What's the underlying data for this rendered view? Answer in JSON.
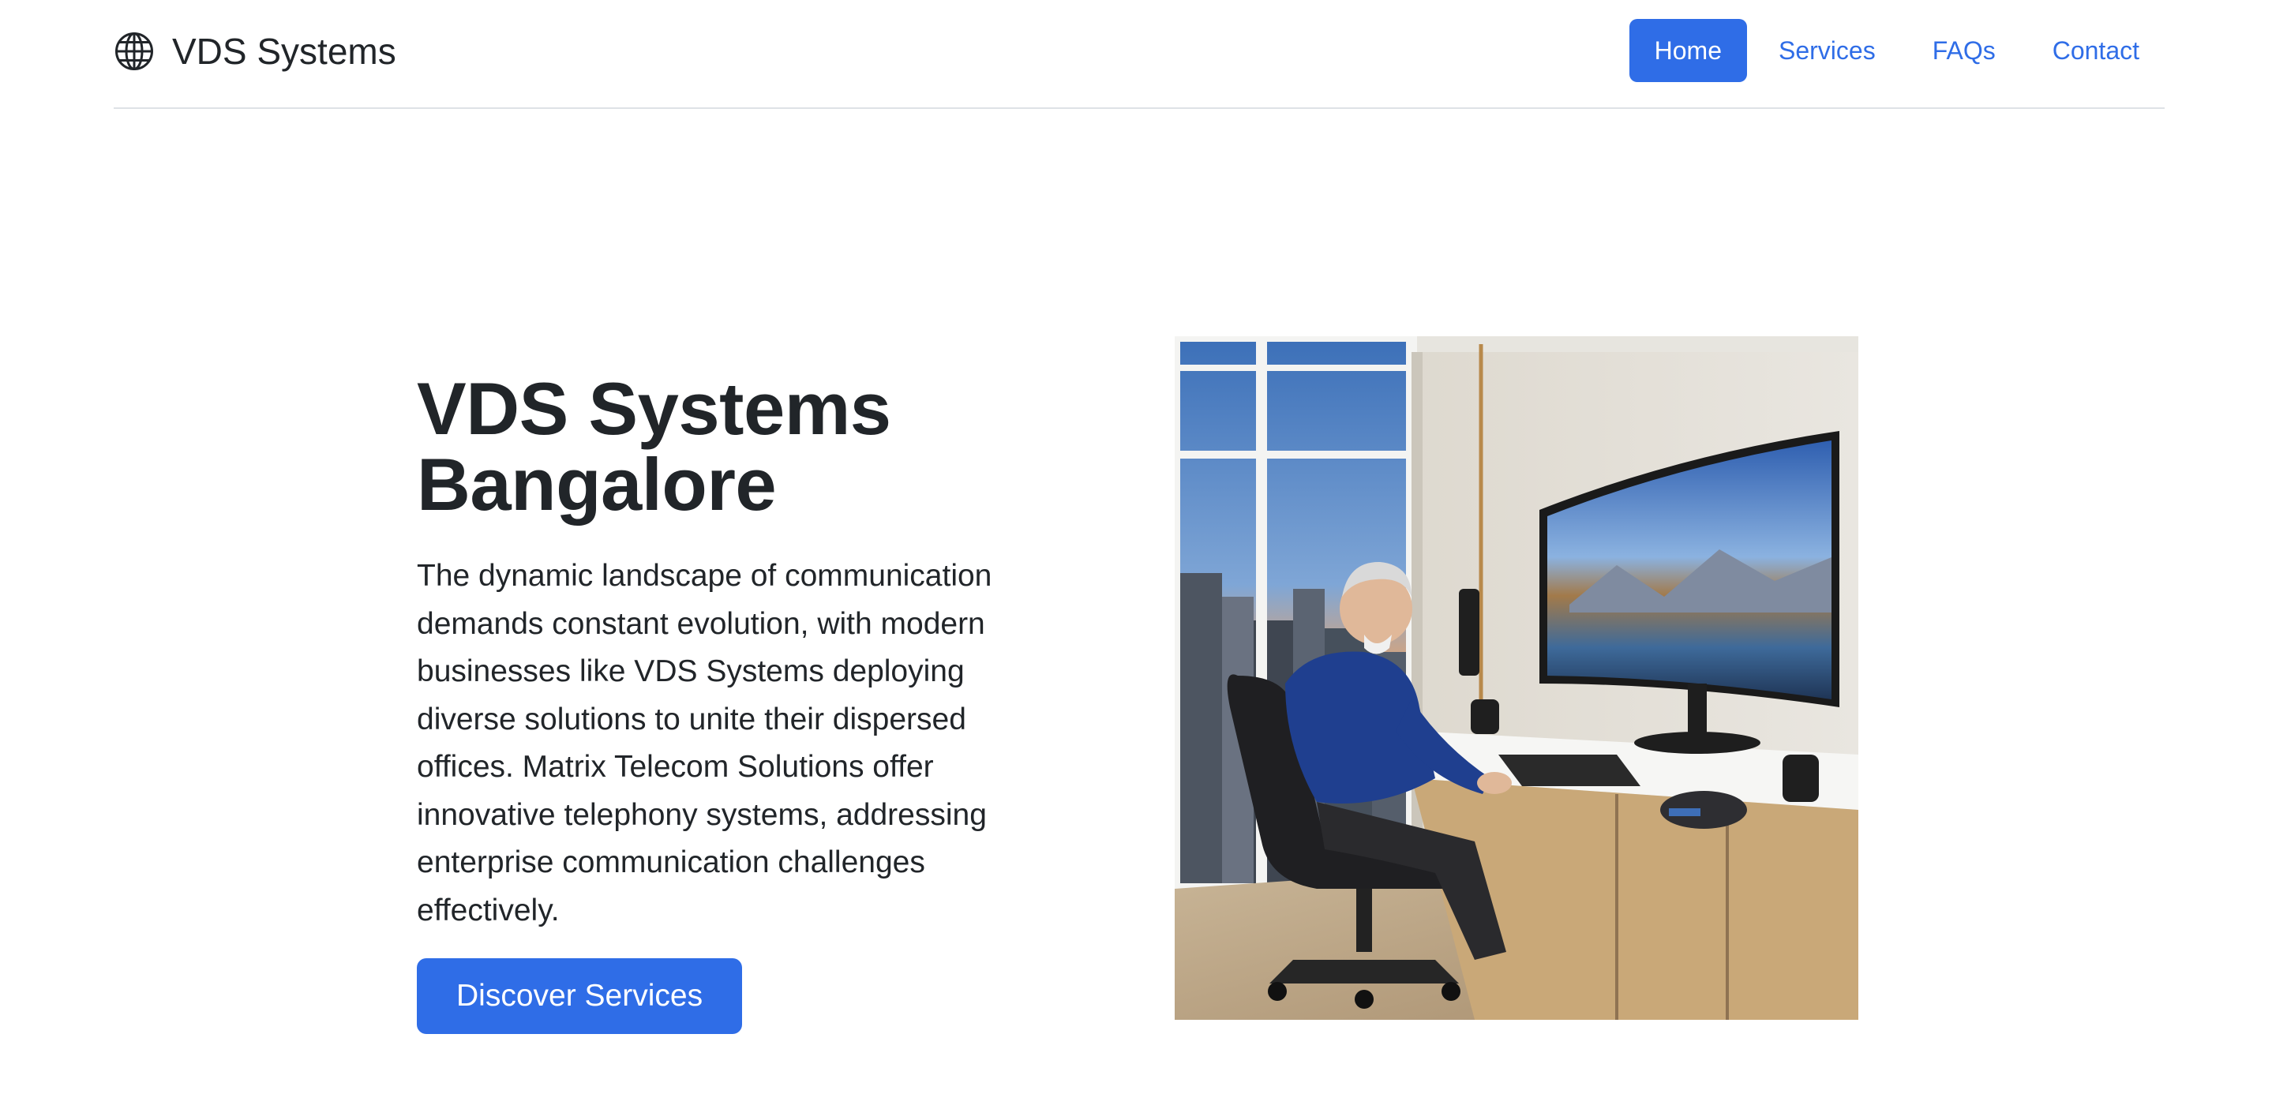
{
  "header": {
    "brand": "VDS Systems",
    "brand_icon": "globe-icon",
    "nav": [
      {
        "label": "Home",
        "active": true
      },
      {
        "label": "Services",
        "active": false
      },
      {
        "label": "FAQs",
        "active": false
      },
      {
        "label": "Contact",
        "active": false
      }
    ]
  },
  "hero": {
    "title_line1": "VDS Systems",
    "title_line2": "Bangalore",
    "lead": "The dynamic landscape of communication demands constant evolution, with modern businesses like VDS Systems deploying diverse solutions to unite their dispersed offices. Matrix Telecom Solutions offer innovative telephony systems, addressing enterprise communication challenges effectively.",
    "cta_label": "Discover Services",
    "image_alt": "Man at curved monitor in office"
  },
  "colors": {
    "accent": "#2f6de7",
    "text": "#212529",
    "divider": "#dee2e6"
  }
}
